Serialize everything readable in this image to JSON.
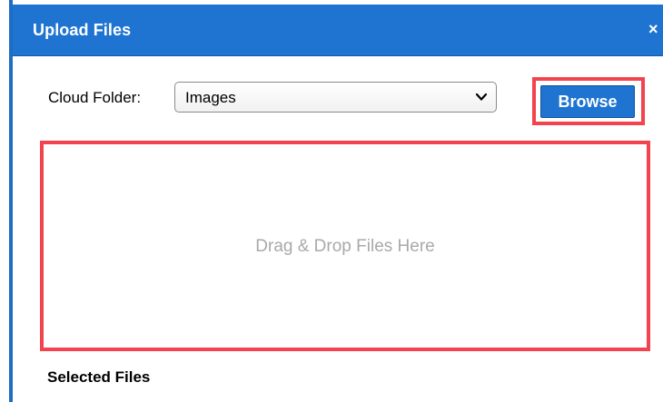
{
  "dialog": {
    "title": "Upload Files",
    "close_symbol": "×"
  },
  "folder": {
    "label": "Cloud Folder:",
    "selected": "Images"
  },
  "browse": {
    "label": "Browse"
  },
  "dropzone": {
    "text": "Drag & Drop Files Here"
  },
  "selected_files": {
    "heading": "Selected Files"
  },
  "icons": {
    "close": "close-icon",
    "select_chevron": "chevron-down-icon"
  },
  "colors": {
    "titlebar": "#1e74d0",
    "highlight_outline": "#f2434e",
    "dropzone_text": "#a9a9a9"
  }
}
